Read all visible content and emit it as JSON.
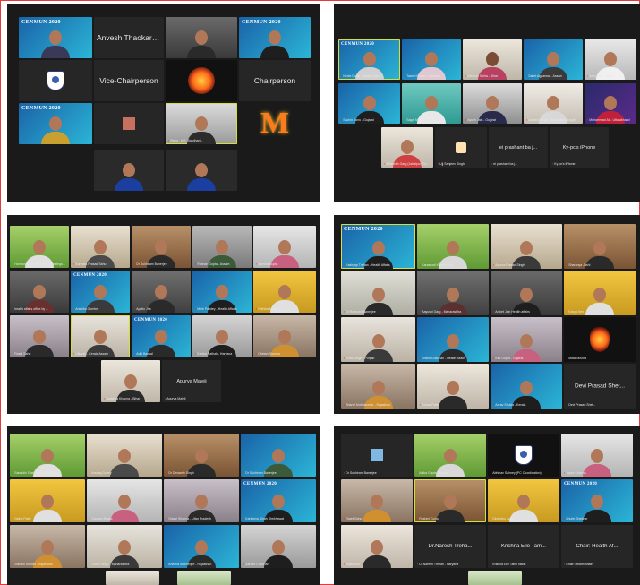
{
  "colors": {
    "speaker_border": "#d8df3b",
    "name_dot": "#e03030",
    "panel_bg": "#1a1a1a",
    "frame_border": "#e23b3b"
  },
  "brand": {
    "cenmun_logo_text": "CENMUN 2020"
  },
  "panel1": {
    "tiles": {
      "anvesh": "Anvesh Thaokar -...",
      "vice_chair": "Vice-Chairperson",
      "chair": "Chairperson",
      "speaker_caption": "Bisha - A.S. Bandhari..."
    }
  },
  "panel2": {
    "tiles": {
      "prashant": "ei prashant ba j...",
      "phone": "Ky-pc's iPhone"
    },
    "captions": [
      "Nonie Dutta - Assam (cand...",
      "Taanvi Manas - Haryana",
      "Abhinav Sinha - Bihar",
      "Saket Aggarwal - Assam",
      "Aditya Pal - Bihar",
      "Sachin Sonu - Gujarat",
      "Sagal Mishra - Karnataka",
      "Ayush Jain - Gujarat",
      "Aravind Singh - Jharkhand (Legal)",
      "Muhammad Ali - Uttarakhand",
      "Abhisekh Garg (Jabalpur) Dubey",
      "Ujj Sanjeev Singh",
      "ei prashant ba j...",
      "Ky-pc's iPhone"
    ]
  },
  "panel3": {
    "tiles": {
      "apurva": "Apurva Maleji"
    },
    "captions": [
      "Harman Sachin Sharma (Paralegal)...",
      "Sunnata Prasad Sahu",
      "Dr Sukhiram Banerjee",
      "Roshan Gupta - Assam",
      "Ayesha Gupta",
      "health affairs office by ...",
      "Anshika Gomber",
      "Apollo Jha",
      "Mihir Pandey - Health Affairs",
      "Krithika Mehrotra",
      "Rashi Sahu",
      "Utkarsh - Kerala Assam",
      "Aditi Bansal",
      "Kanika Pathak - Haryana",
      "Chetan Sharma",
      "Pranjal Mehta - Goa",
      "Nandini Dubey",
      "Tanishka Khanna - Bihar",
      "Apurva Maleji"
    ]
  },
  "panel4": {
    "tiles": {
      "devi": "Devi Prasad Shet..."
    },
    "captions": [
      "Kashyap Trehan - Health Affairs",
      "Karaswati Kumar Goa",
      "Apurva Prasad Singh",
      "Sharanya Joshi",
      "Dr Rajmohit Banerjee",
      "Aayushi Garg - Maharashtra",
      "Aniket Jain Health affairs",
      "Kavya Sen",
      "Amrit Singh - Punjab",
      "Srishti Chauhan - Health Affairs",
      "Kirti Gupta - Gujarat",
      "Mitali Mishra",
      "Aarav Shukla - Kerala",
      "Aparna Gupta",
      "Shailesh Singh - Goa",
      "Bhanvi Muthukumar - Rajasthan",
      "Sohan Patel",
      "Devi Prasad Shet..."
    ]
  },
  "panel5": {
    "captions": [
      "Sannidhi Goel - Uttar Pradesh",
      "Anurag Dubey",
      "Dr Devansh Singh",
      "Dr Sukhiram Banerjee",
      "Naina Patel",
      "Gautam Bhalla",
      "Ojasvi Sharma - Uttar Pradesh",
      "Kartikeya Singh Shekhawat",
      "Shivani Shrinet - Rajasthan",
      "Dhruv Singh - Maharashtra",
      "Bhavna Mukherjee - Rajasthan",
      "Aarush Chauhan",
      "Sundaram Jagannath",
      "Krishna Mishra Rampur"
    ]
  },
  "panel6": {
    "tiles": {
      "naresh": "Dr.Naresh Treha...",
      "krishna": "Krishna Elle Tam...",
      "chair_health": "Chair: Health Af..."
    },
    "captions": [
      "Dr Sukhiram Banerjee",
      "Anika Gupta - Assam",
      "Abhinav Sahney (PC Coordination)",
      "Taylor Khanna",
      "Rashi Sahu",
      "Rashmi Guha",
      "Dipanshu Joshi",
      "Shubh Shekhar",
      "Anjali Dutt",
      "Kanika Mehta",
      "Dr.Naresh Trehan - Haryana",
      "Krishna Elle Tamil Nadu",
      "Chair: Health Affairs"
    ]
  }
}
